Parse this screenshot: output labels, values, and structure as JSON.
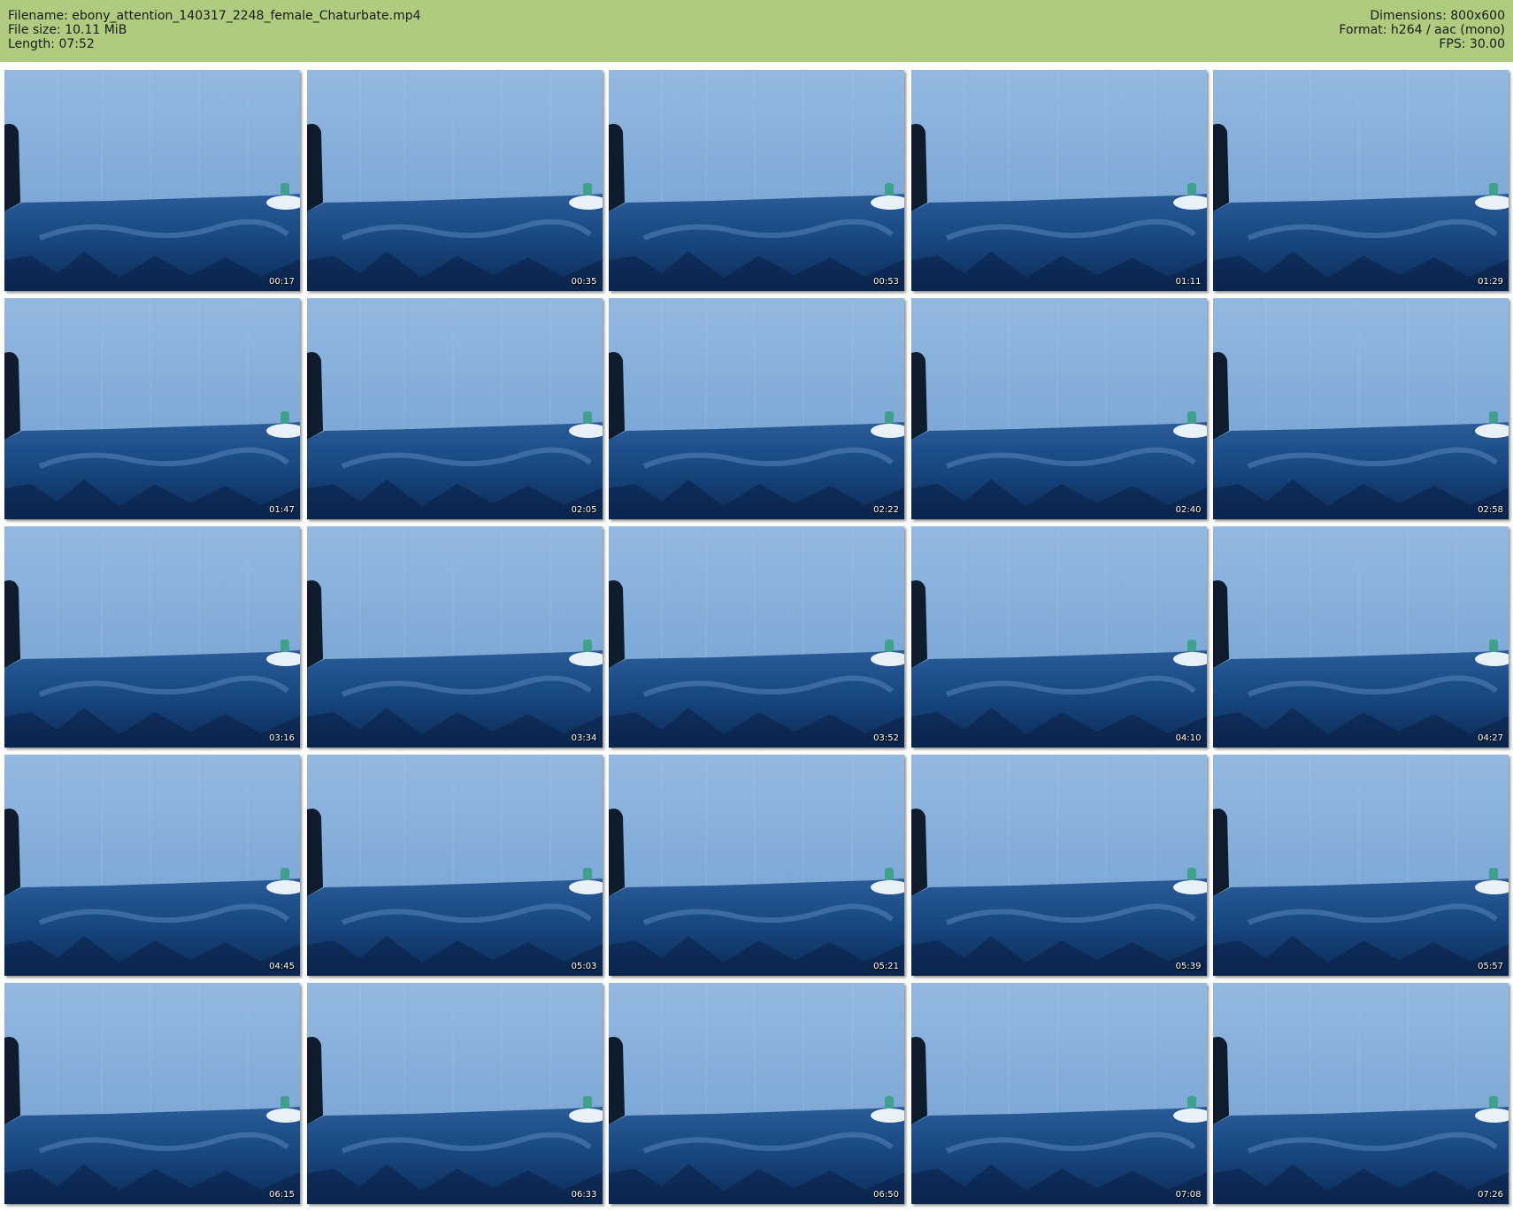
{
  "header": {
    "filename_line": "Filename: ebony_attention_140317_2248_female_Chaturbate.mp4",
    "filesize_line": "File size: 10.11 MiB",
    "length_line": "Length: 07:52",
    "dimensions_line": "Dimensions: 800x600",
    "format_line": "Format: h264 / aac (mono)",
    "fps_line": "FPS: 30.00"
  },
  "thumbnails": [
    "00:17",
    "00:35",
    "00:53",
    "01:11",
    "01:29",
    "01:47",
    "02:05",
    "02:22",
    "02:40",
    "02:58",
    "03:16",
    "03:34",
    "03:52",
    "04:10",
    "04:27",
    "04:45",
    "05:03",
    "05:21",
    "05:39",
    "05:57",
    "06:15",
    "06:33",
    "06:50",
    "07:08",
    "07:26"
  ],
  "colors": {
    "header_bg": "#afcb7f",
    "wall": "#7ba8d8",
    "bedding": "#1d4d8a"
  }
}
